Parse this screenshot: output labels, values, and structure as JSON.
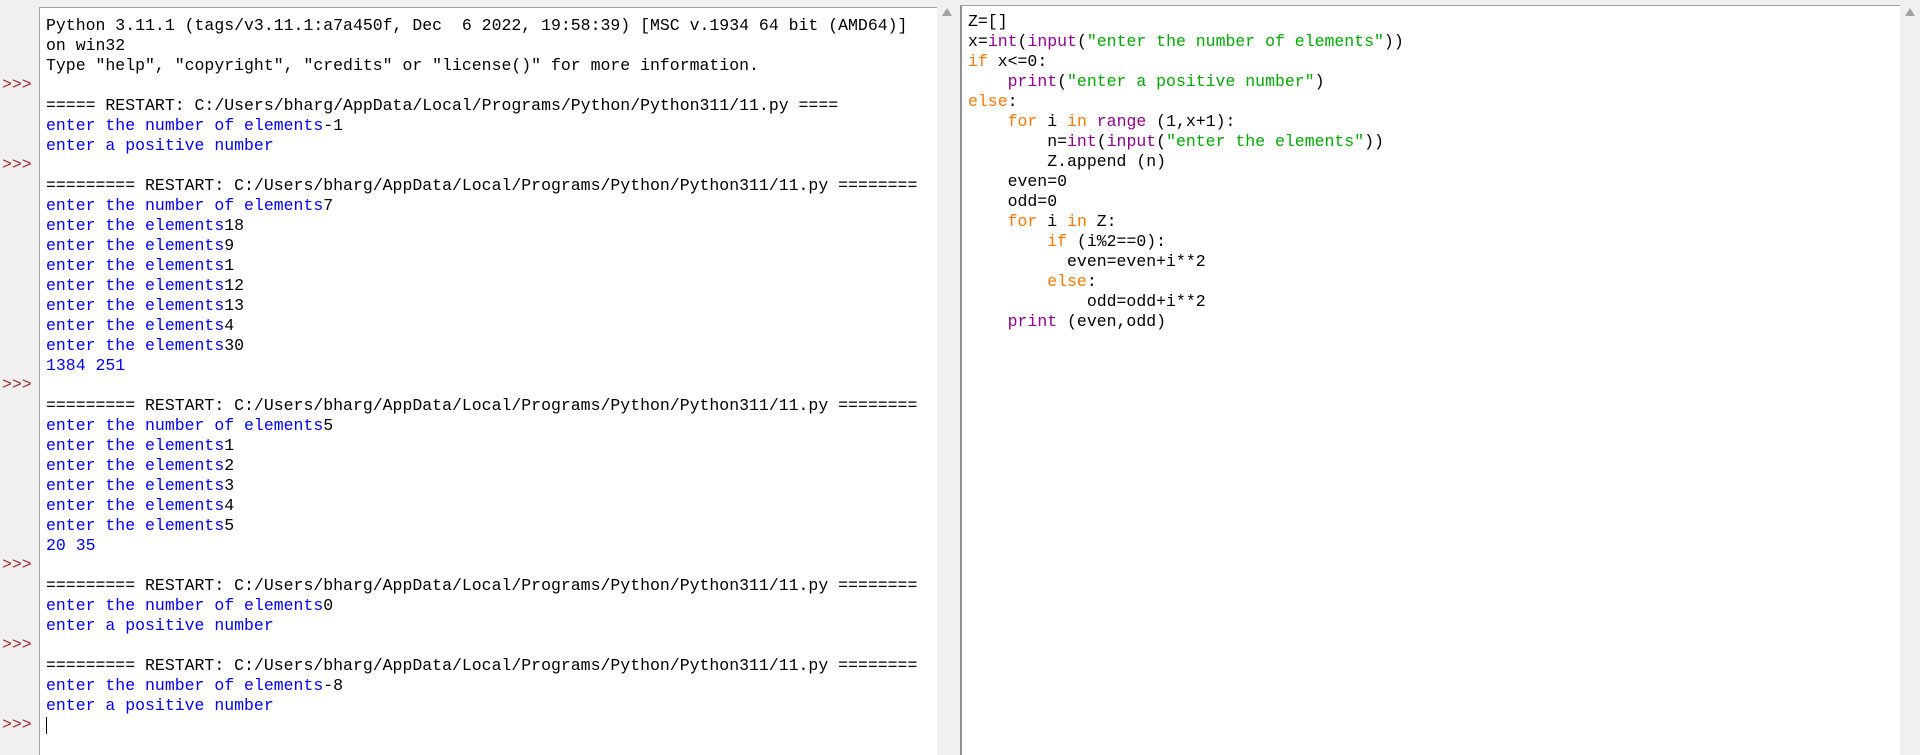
{
  "colors": {
    "stdout": "#0000ff",
    "stdin": "#000000",
    "text": "#000000",
    "keyword": "#ff7700",
    "builtin": "#900090",
    "string": "#00aa00",
    "prompt": "#a52a2a"
  },
  "shell": {
    "prompt_text": ">>>",
    "lines": [
      {
        "seg": [
          [
            "Python 3.11.1 (tags/v3.11.1:a7a450f, Dec  6 2022, 19:58:39) [MSC v.1934 64 bit (AMD64)]",
            "text"
          ]
        ]
      },
      {
        "seg": [
          [
            "on win32",
            "text"
          ]
        ]
      },
      {
        "seg": [
          [
            "Type \"help\", \"copyright\", \"credits\" or \"license()\" for more information.",
            "text"
          ]
        ]
      },
      {
        "prompt": true,
        "seg": []
      },
      {
        "seg": [
          [
            "===== RESTART: C:/Users/bharg/AppData/Local/Programs/Python/Python311/11.py ====",
            "text"
          ]
        ]
      },
      {
        "seg": [
          [
            "enter the number of elements",
            "stdout"
          ],
          [
            "-1",
            "stdin"
          ]
        ]
      },
      {
        "seg": [
          [
            "enter a positive number",
            "stdout"
          ]
        ]
      },
      {
        "prompt": true,
        "seg": []
      },
      {
        "seg": [
          [
            "========= RESTART: C:/Users/bharg/AppData/Local/Programs/Python/Python311/11.py ========",
            "text"
          ]
        ]
      },
      {
        "seg": [
          [
            "enter the number of elements",
            "stdout"
          ],
          [
            "7",
            "stdin"
          ]
        ]
      },
      {
        "seg": [
          [
            "enter the elements",
            "stdout"
          ],
          [
            "18",
            "stdin"
          ]
        ]
      },
      {
        "seg": [
          [
            "enter the elements",
            "stdout"
          ],
          [
            "9",
            "stdin"
          ]
        ]
      },
      {
        "seg": [
          [
            "enter the elements",
            "stdout"
          ],
          [
            "1",
            "stdin"
          ]
        ]
      },
      {
        "seg": [
          [
            "enter the elements",
            "stdout"
          ],
          [
            "12",
            "stdin"
          ]
        ]
      },
      {
        "seg": [
          [
            "enter the elements",
            "stdout"
          ],
          [
            "13",
            "stdin"
          ]
        ]
      },
      {
        "seg": [
          [
            "enter the elements",
            "stdout"
          ],
          [
            "4",
            "stdin"
          ]
        ]
      },
      {
        "seg": [
          [
            "enter the elements",
            "stdout"
          ],
          [
            "30",
            "stdin"
          ]
        ]
      },
      {
        "seg": [
          [
            "1384 251",
            "stdout"
          ]
        ]
      },
      {
        "prompt": true,
        "seg": []
      },
      {
        "seg": [
          [
            "========= RESTART: C:/Users/bharg/AppData/Local/Programs/Python/Python311/11.py ========",
            "text"
          ]
        ]
      },
      {
        "seg": [
          [
            "enter the number of elements",
            "stdout"
          ],
          [
            "5",
            "stdin"
          ]
        ]
      },
      {
        "seg": [
          [
            "enter the elements",
            "stdout"
          ],
          [
            "1",
            "stdin"
          ]
        ]
      },
      {
        "seg": [
          [
            "enter the elements",
            "stdout"
          ],
          [
            "2",
            "stdin"
          ]
        ]
      },
      {
        "seg": [
          [
            "enter the elements",
            "stdout"
          ],
          [
            "3",
            "stdin"
          ]
        ]
      },
      {
        "seg": [
          [
            "enter the elements",
            "stdout"
          ],
          [
            "4",
            "stdin"
          ]
        ]
      },
      {
        "seg": [
          [
            "enter the elements",
            "stdout"
          ],
          [
            "5",
            "stdin"
          ]
        ]
      },
      {
        "seg": [
          [
            "20 35",
            "stdout"
          ]
        ]
      },
      {
        "prompt": true,
        "seg": []
      },
      {
        "seg": [
          [
            "========= RESTART: C:/Users/bharg/AppData/Local/Programs/Python/Python311/11.py ========",
            "text"
          ]
        ]
      },
      {
        "seg": [
          [
            "enter the number of elements",
            "stdout"
          ],
          [
            "0",
            "stdin"
          ]
        ]
      },
      {
        "seg": [
          [
            "enter a positive number",
            "stdout"
          ]
        ]
      },
      {
        "prompt": true,
        "seg": []
      },
      {
        "seg": [
          [
            "========= RESTART: C:/Users/bharg/AppData/Local/Programs/Python/Python311/11.py ========",
            "text"
          ]
        ]
      },
      {
        "seg": [
          [
            "enter the number of elements",
            "stdout"
          ],
          [
            "-8",
            "stdin"
          ]
        ]
      },
      {
        "seg": [
          [
            "enter a positive number",
            "stdout"
          ]
        ]
      },
      {
        "prompt": true,
        "cursor": true,
        "seg": []
      }
    ]
  },
  "editor": {
    "lines": [
      [
        [
          "Z=[]",
          "text"
        ]
      ],
      [
        [
          "x=",
          "text"
        ],
        [
          "int",
          "builtin"
        ],
        [
          "(",
          "text"
        ],
        [
          "input",
          "builtin"
        ],
        [
          "(",
          "text"
        ],
        [
          "\"enter the number of elements\"",
          "string"
        ],
        [
          "))",
          "text"
        ]
      ],
      [
        [
          "if",
          "keyword"
        ],
        [
          " x<=0:",
          "text"
        ]
      ],
      [
        [
          "    ",
          "text"
        ],
        [
          "print",
          "builtin"
        ],
        [
          "(",
          "text"
        ],
        [
          "\"enter a positive number\"",
          "string"
        ],
        [
          ")",
          "text"
        ]
      ],
      [
        [
          "else",
          "keyword"
        ],
        [
          ":",
          "text"
        ]
      ],
      [
        [
          "    ",
          "text"
        ],
        [
          "for",
          "keyword"
        ],
        [
          " i ",
          "text"
        ],
        [
          "in",
          "keyword"
        ],
        [
          " ",
          "text"
        ],
        [
          "range",
          "builtin"
        ],
        [
          " (1,x+1):",
          "text"
        ]
      ],
      [
        [
          "        n=",
          "text"
        ],
        [
          "int",
          "builtin"
        ],
        [
          "(",
          "text"
        ],
        [
          "input",
          "builtin"
        ],
        [
          "(",
          "text"
        ],
        [
          "\"enter the elements\"",
          "string"
        ],
        [
          "))",
          "text"
        ]
      ],
      [
        [
          "        Z.append (n)",
          "text"
        ]
      ],
      [
        [
          "    even=0",
          "text"
        ]
      ],
      [
        [
          "    odd=0",
          "text"
        ]
      ],
      [
        [
          "    ",
          "text"
        ],
        [
          "for",
          "keyword"
        ],
        [
          " i ",
          "text"
        ],
        [
          "in",
          "keyword"
        ],
        [
          " Z:",
          "text"
        ]
      ],
      [
        [
          "        ",
          "text"
        ],
        [
          "if",
          "keyword"
        ],
        [
          " (i%2==0):",
          "text"
        ]
      ],
      [
        [
          "          even=even+i**2",
          "text"
        ]
      ],
      [
        [
          "        ",
          "text"
        ],
        [
          "else",
          "keyword"
        ],
        [
          ":",
          "text"
        ]
      ],
      [
        [
          "            odd=odd+i**2",
          "text"
        ]
      ],
      [
        [
          "    ",
          "text"
        ],
        [
          "print",
          "builtin"
        ],
        [
          " (even,odd)",
          "text"
        ]
      ]
    ]
  }
}
